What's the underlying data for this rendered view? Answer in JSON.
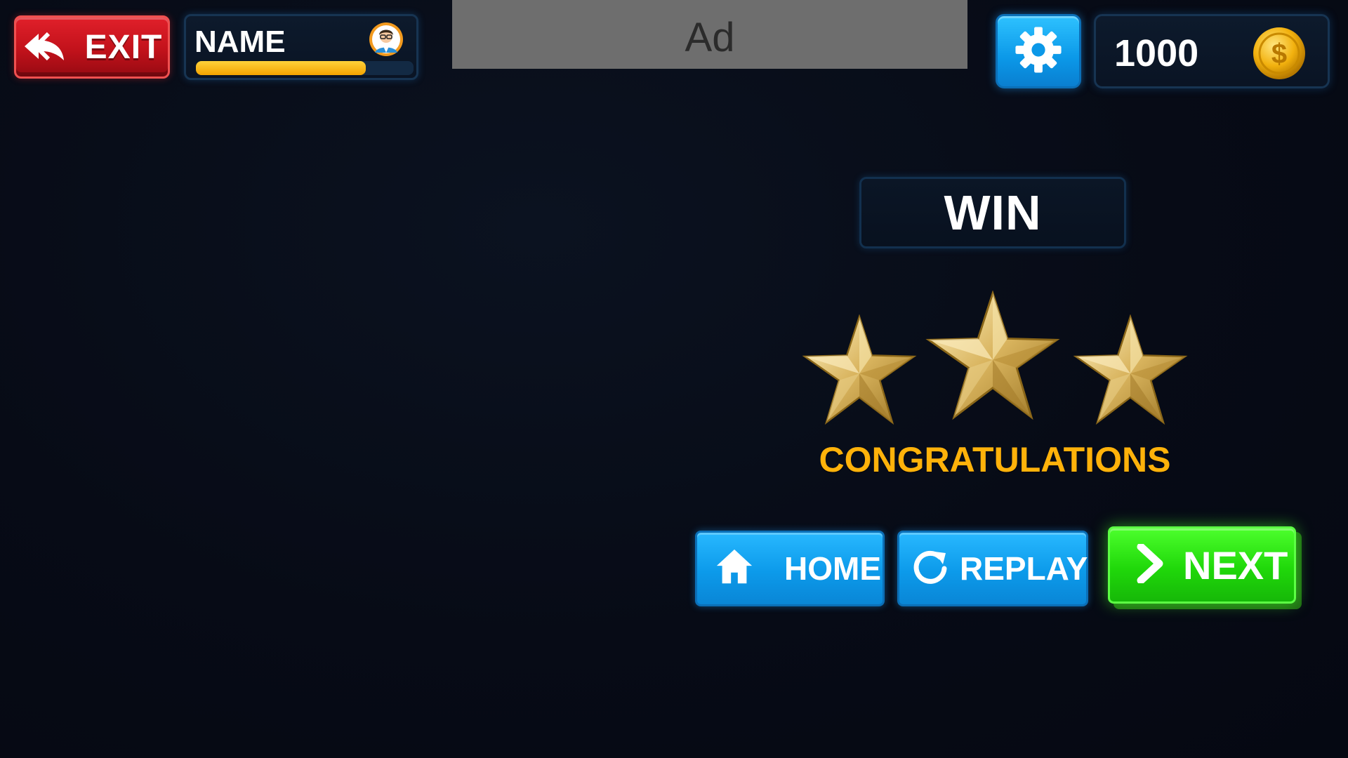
{
  "top_bar": {
    "exit_label": "EXIT",
    "player_name": "NAME",
    "xp_fraction": 0.78,
    "ad_text": "Ad",
    "coins": "1000"
  },
  "result": {
    "title": "WIN",
    "stars_earned": 3,
    "stars_total": 3,
    "message": "CONGRATULATIONS"
  },
  "actions": {
    "home_label": "HOME",
    "replay_label": "REPLAY",
    "next_label": "NEXT"
  },
  "colors": {
    "exit_red": "#c2121b",
    "xp_bar": "#f3a300",
    "blue_button": "#0c9aea",
    "next_green": "#20d80a",
    "congrats_gold": "#ffb20a",
    "star_gold": "#d8b868"
  },
  "icons": {
    "exit": "double-back-arrow-icon",
    "avatar": "player-avatar-icon",
    "settings": "gear-icon",
    "coin": "dollar-coin-icon",
    "home": "home-icon",
    "replay": "replay-icon",
    "next": "chevron-right-icon",
    "star": "gold-star-icon"
  }
}
